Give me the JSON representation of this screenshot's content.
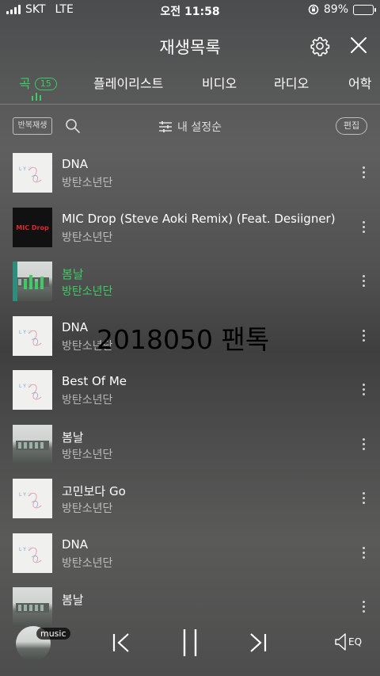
{
  "status_bar": {
    "carrier": "SKT",
    "network": "LTE",
    "time": "오전 11:58",
    "battery": "89%",
    "battery_level": 0.89
  },
  "header": {
    "title": "재생목록"
  },
  "tabs": [
    {
      "label": "곡",
      "badge": "15",
      "active": true
    },
    {
      "label": "플레이리스트"
    },
    {
      "label": "비디오"
    },
    {
      "label": "라디오"
    },
    {
      "label": "어학"
    }
  ],
  "toolbar": {
    "repeat_label": "반복재생",
    "sort_label": "내 설정순",
    "edit_label": "편집"
  },
  "songs": [
    {
      "title": "DNA",
      "artist": "방탄소년단",
      "art": "dna"
    },
    {
      "title": "MIC Drop (Steve Aoki Remix) (Feat. Desiigner)",
      "artist": "방탄소년단",
      "art": "micdrop",
      "art_text": "MIC Drop"
    },
    {
      "title": "봄날",
      "artist": "방탄소년단",
      "art": "spring",
      "playing": true
    },
    {
      "title": "DNA",
      "artist": "방탄소년단",
      "art": "dna"
    },
    {
      "title": "Best Of Me",
      "artist": "방탄소년단",
      "art": "dna"
    },
    {
      "title": "봄날",
      "artist": "방탄소년단",
      "art": "spring"
    },
    {
      "title": "고민보다 Go",
      "artist": "방탄소년단",
      "art": "dna"
    },
    {
      "title": "DNA",
      "artist": "방탄소년단",
      "art": "dna"
    },
    {
      "title": "봄날",
      "artist": "",
      "art": "spring"
    }
  ],
  "overlay_text": "2018050 팬톡",
  "player": {
    "music_tag": "music",
    "eq_label": "EQ"
  },
  "colors": {
    "accent": "#3ecb65"
  }
}
